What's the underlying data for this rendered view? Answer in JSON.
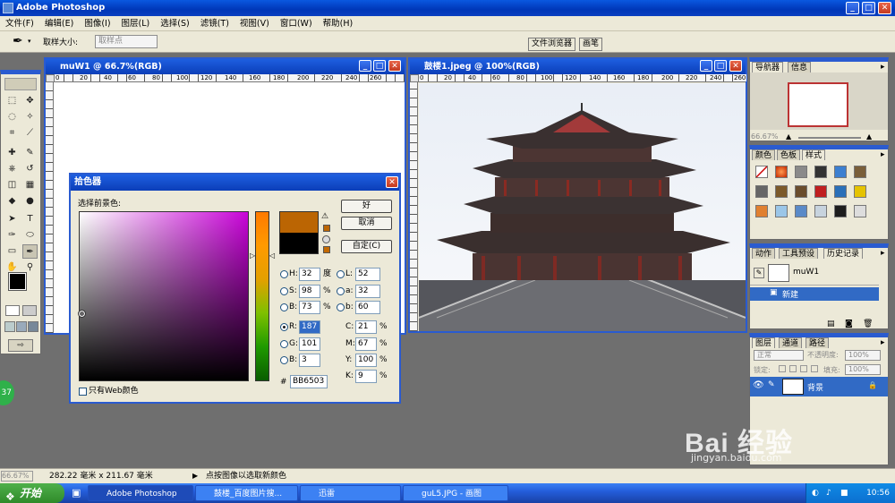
{
  "app": {
    "title": "Adobe Photoshop"
  },
  "menu": [
    "文件(F)",
    "编辑(E)",
    "图像(I)",
    "图层(L)",
    "选择(S)",
    "滤镜(T)",
    "视图(V)",
    "窗口(W)",
    "帮助(H)"
  ],
  "options": {
    "sample_size_label": "取样大小:",
    "sample_size_value": "取样点",
    "file_browser_tab": "文件浏览器",
    "brushes_tab": "画笔"
  },
  "doc1": {
    "title": "muW1 @ 66.7%(RGB)",
    "ruler": [
      "0",
      "20",
      "40",
      "60",
      "80",
      "100",
      "120",
      "140",
      "160",
      "180",
      "200",
      "220",
      "240",
      "260"
    ]
  },
  "doc2": {
    "title": "鼓楼1.jpeg @ 100%(RGB)",
    "ruler": [
      "0",
      "20",
      "40",
      "60",
      "80",
      "100",
      "120",
      "140",
      "160",
      "180",
      "200",
      "220",
      "240",
      "260"
    ]
  },
  "picker": {
    "title": "拾色器",
    "prompt": "选择前景色:",
    "ok": "好",
    "cancel": "取消",
    "custom": "自定(C)",
    "web_only": "只有Web颜色",
    "new_color": "#bb6503",
    "old_color": "#000000",
    "h": {
      "label": "H:",
      "value": "32",
      "unit": "度"
    },
    "s": {
      "label": "S:",
      "value": "98",
      "unit": "%"
    },
    "b": {
      "label": "B:",
      "value": "73",
      "unit": "%"
    },
    "r": {
      "label": "R:",
      "value": "187"
    },
    "g": {
      "label": "G:",
      "value": "101"
    },
    "bl": {
      "label": "B:",
      "value": "3"
    },
    "l": {
      "label": "L:",
      "value": "52"
    },
    "a": {
      "label": "a:",
      "value": "32"
    },
    "lb": {
      "label": "b:",
      "value": "60"
    },
    "c": {
      "label": "C:",
      "value": "21",
      "unit": "%"
    },
    "m": {
      "label": "M:",
      "value": "67",
      "unit": "%"
    },
    "y": {
      "label": "Y:",
      "value": "100",
      "unit": "%"
    },
    "k": {
      "label": "K:",
      "value": "9",
      "unit": "%"
    },
    "hex_label": "#",
    "hex": "BB6503"
  },
  "navigator": {
    "tabs": [
      "导航器",
      "信息"
    ],
    "zoom": "66.67%"
  },
  "styles": {
    "tabs": [
      "颜色",
      "色板",
      "样式"
    ]
  },
  "history": {
    "tabs": [
      "动作",
      "工具预设",
      "历史记录"
    ],
    "items": [
      "muW1",
      "新建"
    ]
  },
  "layers": {
    "tabs": [
      "图层",
      "通道",
      "路径"
    ],
    "blend": "正常",
    "opacity_label": "不透明度:",
    "opacity": "100%",
    "lock_label": "锁定:",
    "fill_label": "填充:",
    "fill": "100%",
    "layer_name": "背景"
  },
  "status": {
    "zoom": "66.67%",
    "size": "282.22 毫米 x 211.67 毫米",
    "hint": "点按图像以选取新颜色"
  },
  "taskbar": {
    "start": "开始",
    "tasks": [
      "Adobe Photoshop",
      "鼓楼_百度图片搜...",
      "迅雷",
      "guL5.JPG - 画图"
    ],
    "time": "10:56"
  },
  "watermark": {
    "text": "Bai 经验",
    "url": "jingyan.baidu.com"
  },
  "badge": "37",
  "colors": {
    "accent": "#2a5bd0",
    "foreground": "#000000",
    "picked": "#bb6503"
  }
}
